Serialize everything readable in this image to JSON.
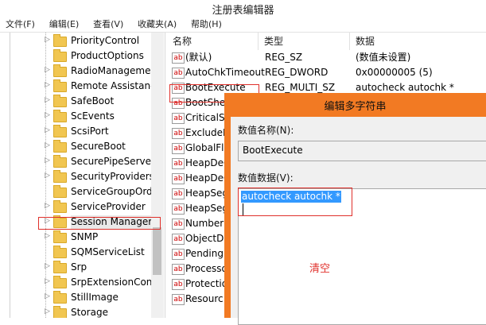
{
  "window": {
    "title": "注册表编辑器"
  },
  "menu": [
    "文件(F)",
    "编辑(E)",
    "查看(V)",
    "收藏夹(A)",
    "帮助(H)"
  ],
  "tree": {
    "items": [
      {
        "label": "PriorityControl",
        "expandable": true
      },
      {
        "label": "ProductOptions",
        "expandable": false
      },
      {
        "label": "RadioManageme",
        "expandable": true
      },
      {
        "label": "Remote Assistanc",
        "expandable": true
      },
      {
        "label": "SafeBoot",
        "expandable": true
      },
      {
        "label": "ScEvents",
        "expandable": true
      },
      {
        "label": "ScsiPort",
        "expandable": true
      },
      {
        "label": "SecureBoot",
        "expandable": true
      },
      {
        "label": "SecurePipeServers",
        "expandable": true
      },
      {
        "label": "SecurityProviders",
        "expandable": true
      },
      {
        "label": "ServiceGroupOrde",
        "expandable": false
      },
      {
        "label": "ServiceProvider",
        "expandable": true
      },
      {
        "label": "Session Manager",
        "expandable": true,
        "selected": true
      },
      {
        "label": "SNMP",
        "expandable": true
      },
      {
        "label": "SQMServiceList",
        "expandable": false
      },
      {
        "label": "Srp",
        "expandable": true
      },
      {
        "label": "SrpExtensionConfi",
        "expandable": true
      },
      {
        "label": "StillImage",
        "expandable": true
      },
      {
        "label": "Storage",
        "expandable": true
      }
    ]
  },
  "list": {
    "headers": {
      "name": "名称",
      "type": "类型",
      "data": "数据"
    },
    "rows": [
      {
        "name": "(默认)",
        "type": "REG_SZ",
        "data": "(数值未设置)"
      },
      {
        "name": "AutoChkTimeout",
        "type": "REG_DWORD",
        "data": "0x00000005 (5)"
      },
      {
        "name": "BootExecute",
        "type": "REG_MULTI_SZ",
        "data": "autocheck autochk *"
      },
      {
        "name": "BootShe",
        "type": "",
        "data": ""
      },
      {
        "name": "CriticalSe",
        "type": "",
        "data": ""
      },
      {
        "name": "ExcludeF",
        "type": "",
        "data": ""
      },
      {
        "name": "GlobalFla",
        "type": "",
        "data": ""
      },
      {
        "name": "HeapDeC",
        "type": "",
        "data": ""
      },
      {
        "name": "HeapDeC",
        "type": "",
        "data": ""
      },
      {
        "name": "HeapSeg",
        "type": "",
        "data": ""
      },
      {
        "name": "HeapSeg",
        "type": "",
        "data": ""
      },
      {
        "name": "Number",
        "type": "",
        "data": ""
      },
      {
        "name": "ObjectDi",
        "type": "",
        "data": ""
      },
      {
        "name": "PendingI",
        "type": "",
        "data": ""
      },
      {
        "name": "Processo",
        "type": "",
        "data": ""
      },
      {
        "name": "Protectio",
        "type": "",
        "data": ""
      },
      {
        "name": "Resourc",
        "type": "",
        "data": ""
      }
    ]
  },
  "dialog": {
    "title": "编辑多字符串",
    "name_label": "数值名称(N):",
    "name_value": "BootExecute",
    "data_label": "数值数据(V):",
    "data_value": "autocheck autochk *",
    "annotation": "清空",
    "colors": {
      "frame": "#f27a23",
      "annotation": "#e0302b",
      "highlight": "#3399ff"
    }
  }
}
